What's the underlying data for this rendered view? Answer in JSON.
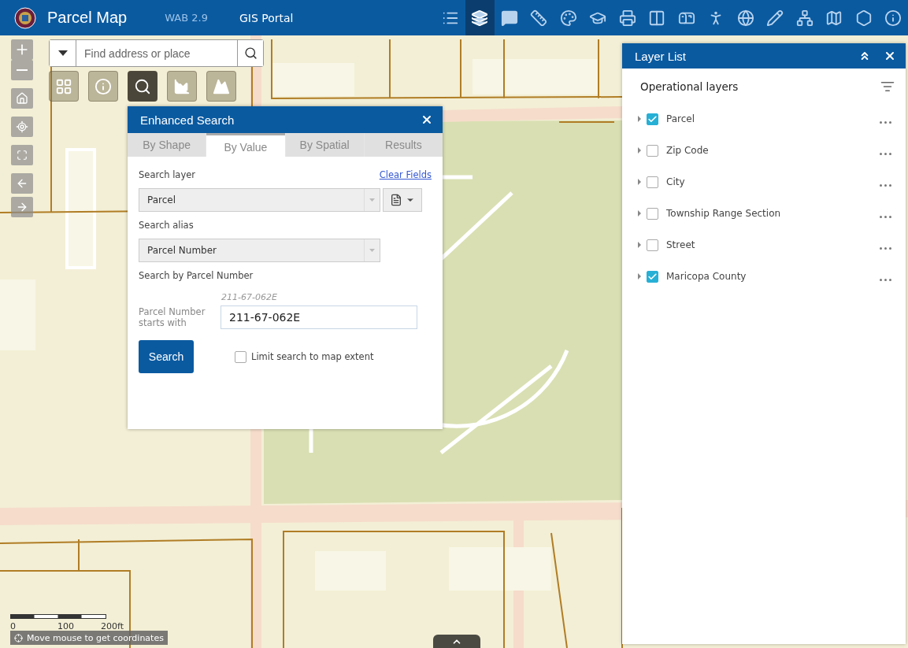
{
  "header": {
    "title": "Parcel Map",
    "version": "WAB 2.9",
    "portal_link": "GIS Portal",
    "toolbar": [
      {
        "kind": "list",
        "selected": false
      },
      {
        "kind": "layers",
        "selected": true
      },
      {
        "kind": "bubble",
        "selected": false
      },
      {
        "kind": "ruler",
        "selected": false
      },
      {
        "kind": "palette",
        "selected": false
      },
      {
        "kind": "cap",
        "selected": false
      },
      {
        "kind": "printer",
        "selected": false
      },
      {
        "kind": "split",
        "selected": false
      },
      {
        "kind": "mailbox",
        "selected": false
      },
      {
        "kind": "person",
        "selected": false
      },
      {
        "kind": "globe",
        "selected": false
      },
      {
        "kind": "pencil",
        "selected": false
      },
      {
        "kind": "network",
        "selected": false
      },
      {
        "kind": "map",
        "selected": false
      },
      {
        "kind": "hexagon",
        "selected": false
      },
      {
        "kind": "info",
        "selected": false
      }
    ]
  },
  "search": {
    "placeholder": "Find address or place"
  },
  "widgets": [
    {
      "kind": "grid",
      "selected": false
    },
    {
      "kind": "info",
      "selected": false
    },
    {
      "kind": "search",
      "selected": true
    },
    {
      "kind": "chart",
      "selected": false
    },
    {
      "kind": "profile",
      "selected": false
    }
  ],
  "dialog": {
    "title": "Enhanced Search",
    "tabs": [
      {
        "label": "By Shape",
        "selected": false
      },
      {
        "label": "By Value",
        "selected": true
      },
      {
        "label": "By Spatial",
        "selected": false
      },
      {
        "label": "Results",
        "selected": false
      }
    ],
    "search_layer_label": "Search layer",
    "clear_fields": "Clear Fields",
    "search_layer": "Parcel",
    "alias_label": "Search alias",
    "alias": "Parcel Number",
    "search_by": "Search by Parcel Number",
    "example": "211-67-062E",
    "field_label": "Parcel Number starts with",
    "field_value": "211-67-062E",
    "search_button": "Search",
    "limit": {
      "label": "Limit search to map extent",
      "checked": false
    }
  },
  "layer_list": {
    "title": "Layer List",
    "section": "Operational layers",
    "layers": [
      {
        "name": "Parcel",
        "checked": true
      },
      {
        "name": "Zip Code",
        "checked": false
      },
      {
        "name": "City",
        "checked": false
      },
      {
        "name": "Township Range Section",
        "checked": false
      },
      {
        "name": "Street",
        "checked": false
      },
      {
        "name": "Maricopa County",
        "checked": true
      }
    ]
  },
  "scale": {
    "labels": [
      "0",
      "100",
      "200ft"
    ]
  },
  "coordinates": "Move mouse to get coordinates"
}
